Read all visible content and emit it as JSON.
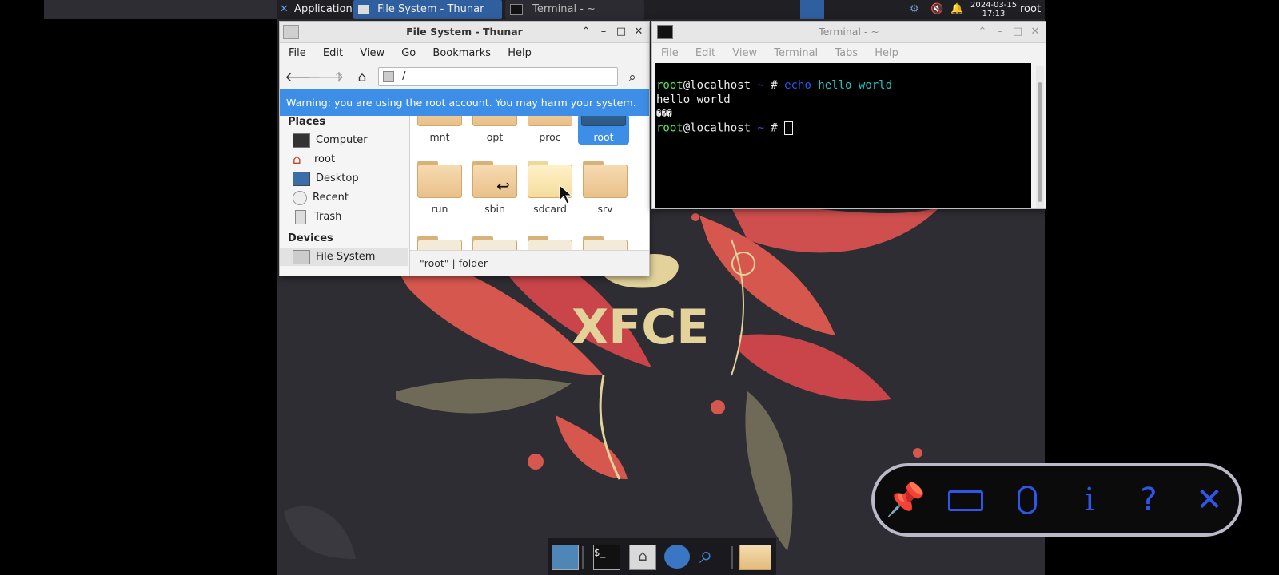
{
  "panel": {
    "applications": "Applications",
    "tasks": [
      "File System - Thunar",
      "Terminal - ~"
    ],
    "clock_date": "2024-03-15",
    "clock_time": "17:13",
    "user": "root"
  },
  "thunar": {
    "title": "File System - Thunar",
    "menu": [
      "File",
      "Edit",
      "View",
      "Go",
      "Bookmarks",
      "Help"
    ],
    "location": "/",
    "warning": "Warning: you are using the root account. You may harm your system.",
    "places_header": "Places",
    "places": [
      "Computer",
      "root",
      "Desktop",
      "Recent",
      "Trash"
    ],
    "devices_header": "Devices",
    "devices": [
      "File System"
    ],
    "folders_row1": [
      "mnt",
      "opt",
      "proc",
      "root"
    ],
    "folders_row2": [
      "run",
      "sbin",
      "sdcard",
      "srv"
    ],
    "selected": "root",
    "status": "\"root\"  |  folder"
  },
  "terminal": {
    "title": "Terminal - ~",
    "menu": [
      "File",
      "Edit",
      "View",
      "Terminal",
      "Tabs",
      "Help"
    ],
    "lines": {
      "l1_user": "root",
      "l1_host": "@localhost",
      "l1_path": " ~",
      "l1_prompt": " # ",
      "l1_cmd": "echo",
      "l1_arg": " hello world",
      "l2": "hello world",
      "l3": "���",
      "l4_user": "root",
      "l4_host": "@localhost",
      "l4_path": " ~",
      "l4_prompt": " # "
    }
  },
  "wallpaper": {
    "logo": "XFCE"
  },
  "colors": {
    "accent": "#3d8ee6",
    "remote_blue": "#2f56e8",
    "desktop_bg": "#2e2d33"
  }
}
